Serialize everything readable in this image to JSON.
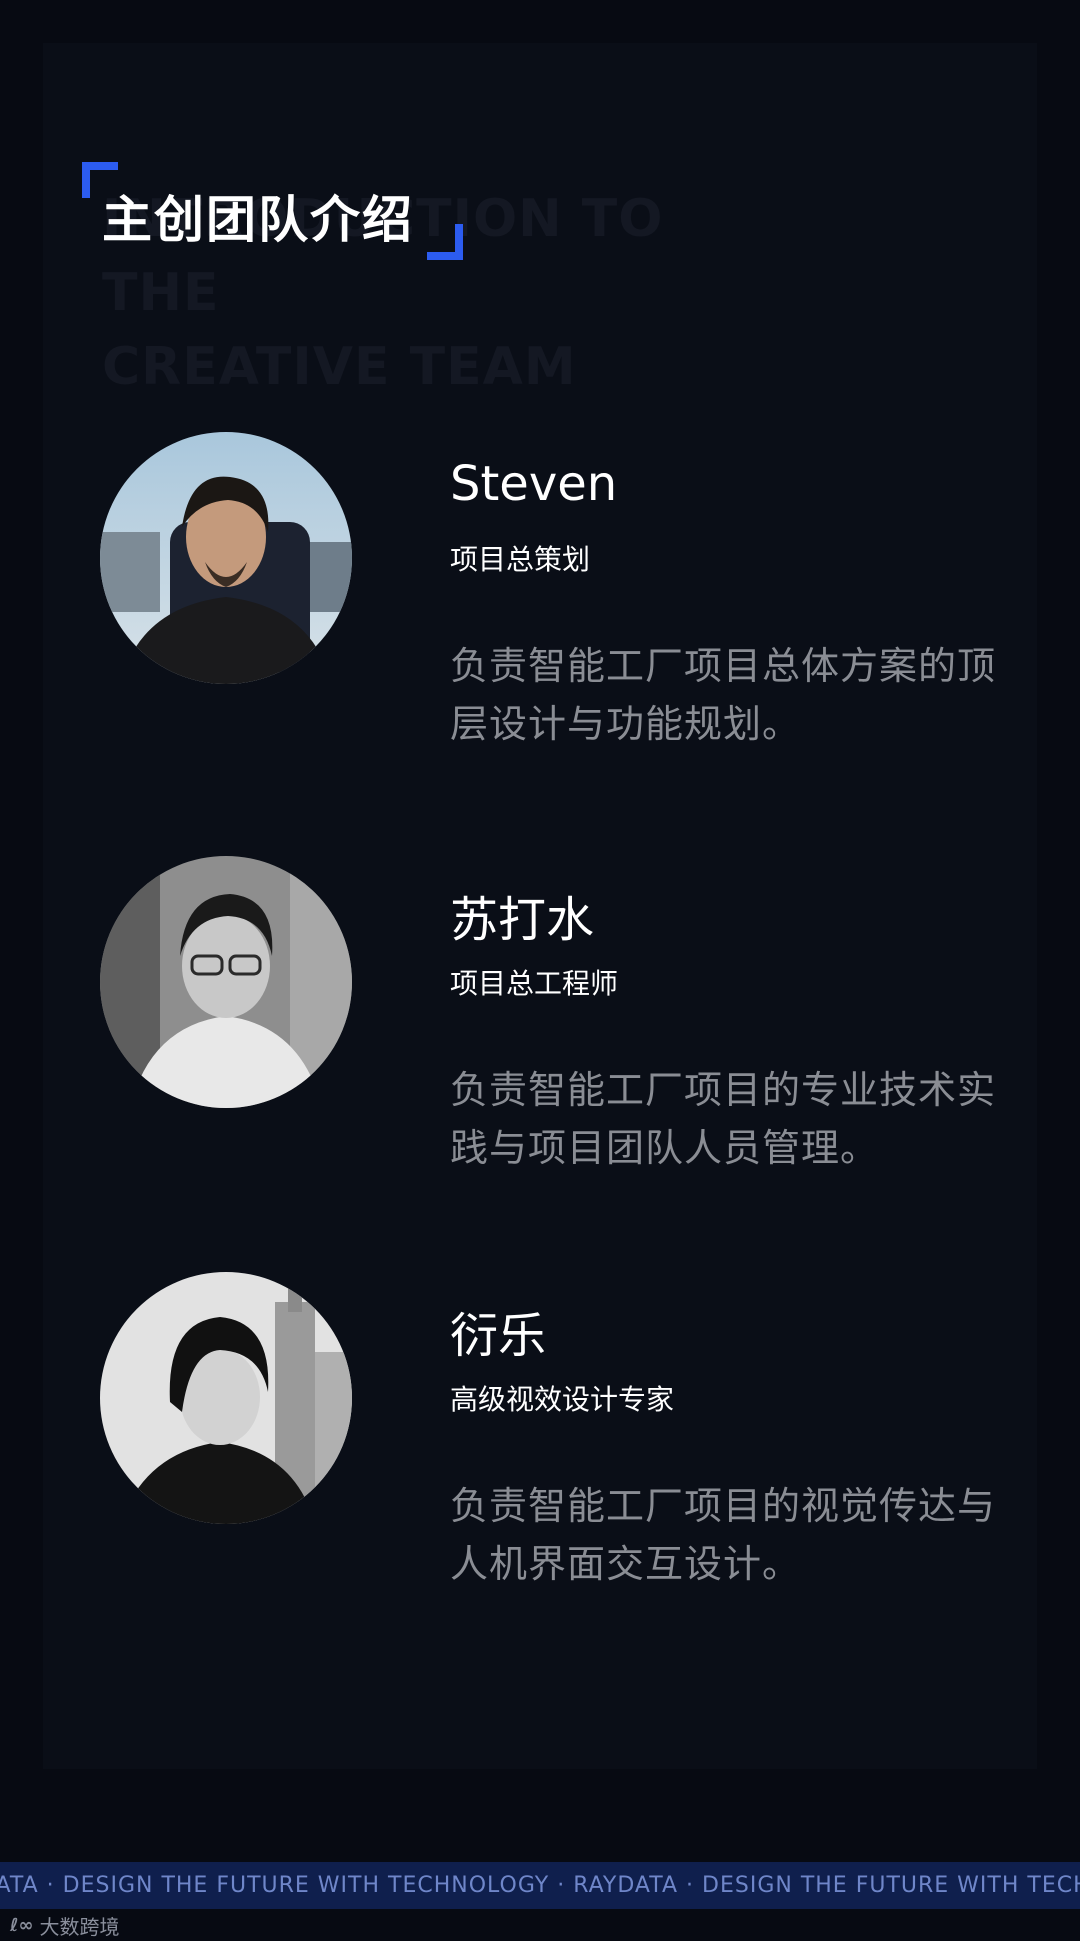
{
  "header": {
    "title_zh": "主创团队介绍",
    "title_en": "INTRODUCTION TO THE\nCREATIVE TEAM",
    "accent_color": "#2c5cf0"
  },
  "members": [
    {
      "name": "Steven",
      "role": "项目总策划",
      "description": "负责智能工厂项目总体方案的顶层设计与功能规划。",
      "avatar": "portrait-photo-color"
    },
    {
      "name": "苏打水",
      "role": "项目总工程师",
      "description": "负责智能工厂项目的专业技术实践与项目团队人员管理。",
      "avatar": "portrait-photo-bw"
    },
    {
      "name": "衍乐",
      "role": "高级视效设计专家",
      "description": "负责智能工厂项目的视觉传达与人机界面交互设计。",
      "avatar": "portrait-photo-bw"
    }
  ],
  "footer": {
    "marquee": "DATA  ·  DESIGN THE FUTURE WITH TECHNOLOGY  ·  RAYDATA  ·  DESIGN THE FUTURE WITH TECHNOLOGY",
    "logo_mark": "ℓ∞",
    "logo_text": "大数跨境"
  }
}
